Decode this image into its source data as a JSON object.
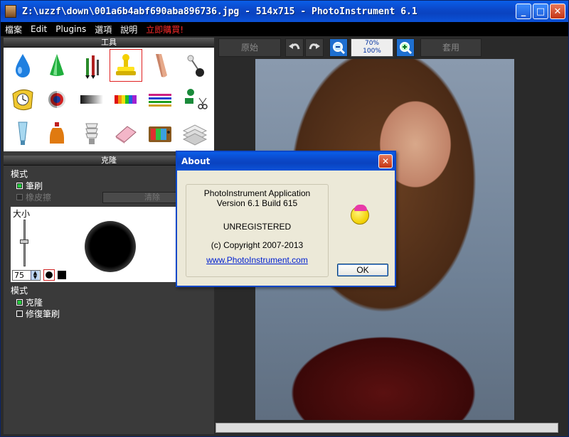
{
  "window": {
    "title": "Z:\\uzzf\\down\\001a6b4abf690aba896736.jpg - 514x715 - PhotoInstrument 6.1",
    "minimize": "_",
    "maximize": "□",
    "close": "✕"
  },
  "menu": {
    "items": [
      "檔案",
      "Edit",
      "Plugins",
      "選項",
      "說明"
    ],
    "promo": "立即購買!"
  },
  "tools_panel": {
    "title": "工具",
    "tools": [
      {
        "name": "water-drop-icon"
      },
      {
        "name": "cone-icon"
      },
      {
        "name": "brushes-icon"
      },
      {
        "name": "clone-stamp-icon",
        "selected": true
      },
      {
        "name": "finger-icon"
      },
      {
        "name": "pin-icon"
      },
      {
        "name": "clock-icon"
      },
      {
        "name": "target-icon"
      },
      {
        "name": "gradient-icon"
      },
      {
        "name": "rainbow-icon"
      },
      {
        "name": "color-lines-icon"
      },
      {
        "name": "scissors-icon"
      },
      {
        "name": "tube-icon"
      },
      {
        "name": "bottle-icon"
      },
      {
        "name": "lamp-icon"
      },
      {
        "name": "eraser-icon"
      },
      {
        "name": "tv-icon"
      },
      {
        "name": "text-icon"
      }
    ]
  },
  "clone_panel": {
    "title": "克隆",
    "mode_label": "模式",
    "brush_option": "筆刷",
    "eraser_option": "橡皮擦",
    "clear_button": "清除",
    "size_label": "大小",
    "size_value": "75",
    "mode2_label": "模式",
    "clone_option": "克隆",
    "repair_option": "修復筆刷"
  },
  "toolbar": {
    "original_button": "原始",
    "apply_button": "套用",
    "zoom_top": "70%",
    "zoom_bottom": "100%"
  },
  "about": {
    "title": "About",
    "app_name": "PhotoInstrument Application",
    "version": "Version 6.1 Build 615",
    "status": "UNREGISTERED",
    "copyright": "(c) Copyright 2007-2013",
    "link": "www.PhotoInstrument.com",
    "ok_button": "OK"
  }
}
